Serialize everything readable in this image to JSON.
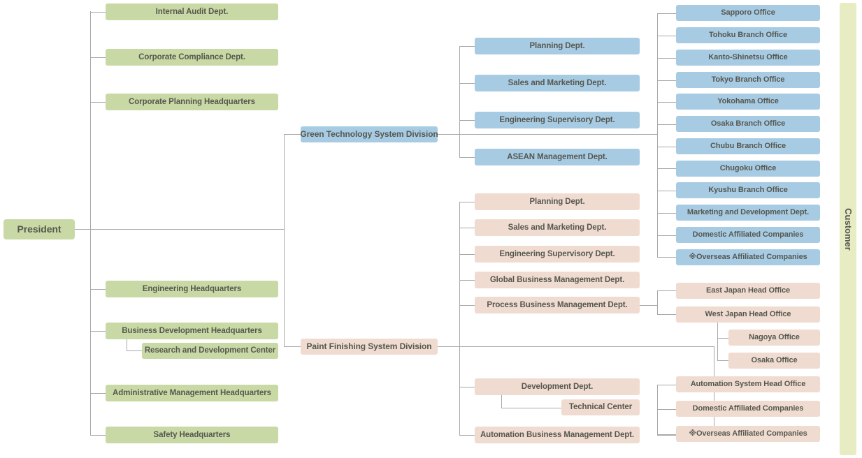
{
  "root": {
    "label": "President"
  },
  "corporate_units": [
    {
      "label": "Internal Audit Dept."
    },
    {
      "label": "Corporate Compliance Dept."
    },
    {
      "label": "Corporate Planning Headquarters"
    },
    {
      "label": "Engineering Headquarters"
    },
    {
      "label": "Business Development Headquarters"
    },
    {
      "label": "Administrative Management Headquarters"
    },
    {
      "label": "Safety Headquarters"
    }
  ],
  "corporate_sub_units": [
    {
      "label": "Research and Development Center",
      "parent": "Business Development Headquarters"
    }
  ],
  "divisions": [
    {
      "label": "Green Technology System Division"
    },
    {
      "label": "Paint Finishing System Division"
    }
  ],
  "green_division_departments": [
    {
      "label": "Planning Dept."
    },
    {
      "label": "Sales and Marketing Dept."
    },
    {
      "label": "Engineering Supervisory Dept."
    },
    {
      "label": "ASEAN Management Dept."
    }
  ],
  "green_division_offices": [
    {
      "label": "Sapporo Office"
    },
    {
      "label": "Tohoku Branch Office"
    },
    {
      "label": "Kanto-Shinetsu Office"
    },
    {
      "label": "Tokyo Branch Office"
    },
    {
      "label": "Yokohama Office"
    },
    {
      "label": "Osaka Branch Office"
    },
    {
      "label": "Chubu Branch Office"
    },
    {
      "label": "Chugoku Office"
    },
    {
      "label": "Kyushu Branch Office"
    },
    {
      "label": "Marketing and Development Dept."
    },
    {
      "label": "Domestic Affiliated Companies"
    },
    {
      "label": "※Overseas Affiliated Companies"
    }
  ],
  "paint_division_departments": [
    {
      "label": "Planning Dept."
    },
    {
      "label": "Sales and Marketing Dept."
    },
    {
      "label": "Engineering Supervisory Dept."
    },
    {
      "label": "Global Business Management Dept."
    },
    {
      "label": "Process Business Management  Dept."
    },
    {
      "label": "Development Dept."
    },
    {
      "label": "Automation Business Management Dept."
    }
  ],
  "paint_division_sub_units": [
    {
      "label": "Technical Center",
      "parent": "Development Dept."
    }
  ],
  "process_business_offices": [
    {
      "label": "East Japan Head Office"
    },
    {
      "label": "West Japan Head Office"
    }
  ],
  "west_japan_sub_offices": [
    {
      "label": "Nagoya Office"
    },
    {
      "label": "Osaka Office"
    }
  ],
  "automation_offices": [
    {
      "label": "Automation System Head Office"
    },
    {
      "label": "Domestic Affiliated Companies"
    },
    {
      "label": "※Overseas Affiliated Companies"
    }
  ],
  "customer": {
    "label": "Customer"
  },
  "colors": {
    "corporate": "#c9d9a5",
    "green_division": "#a8cbe4",
    "paint_division": "#f0dbd0",
    "customer": "#e8ecc3",
    "connector": "#a8a8a8",
    "text": "#55584f"
  }
}
